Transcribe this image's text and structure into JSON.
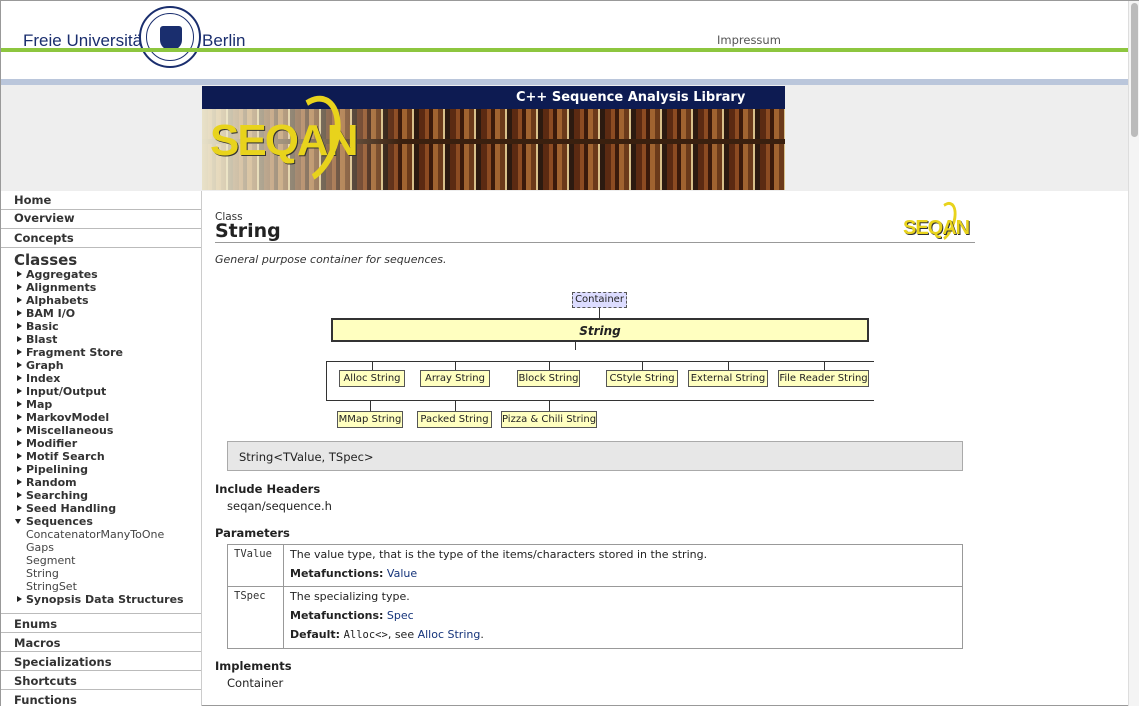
{
  "header": {
    "university_left": "Freie Universität",
    "university_right": "Berlin",
    "impressum": "Impressum"
  },
  "banner": {
    "title": "C++ Sequence Analysis Library",
    "logo_text": "SEQAN"
  },
  "sidebar": {
    "top_links": [
      "Home",
      "Overview",
      "Concepts"
    ],
    "classes_heading": "Classes",
    "class_groups": [
      "Aggregates",
      "Alignments",
      "Alphabets",
      "BAM I/O",
      "Basic",
      "Blast",
      "Fragment Store",
      "Graph",
      "Index",
      "Input/Output",
      "Map",
      "MarkovModel",
      "Miscellaneous",
      "Modifier",
      "Motif Search",
      "Pipelining",
      "Random",
      "Searching",
      "Seed Handling"
    ],
    "expanded_group": "Sequences",
    "sequences_items": [
      "ConcatenatorManyToOne",
      "Gaps",
      "Segment",
      "String",
      "StringSet"
    ],
    "after_group": "Synopsis Data Structures",
    "bottom_links": [
      "Enums",
      "Macros",
      "Specializations",
      "Shortcuts",
      "Functions"
    ]
  },
  "main": {
    "class_label": "Class",
    "title": "String",
    "logo_text": "SEQAN",
    "summary": "General purpose container for sequences.",
    "diagram": {
      "parent": "Container",
      "center": "String",
      "row1": [
        "Alloc String",
        "Array String",
        "Block String",
        "CStyle String",
        "External String",
        "File Reader String"
      ],
      "row2": [
        "MMap String",
        "Packed String",
        "Pizza & Chili String"
      ]
    },
    "signature": "String<TValue, TSpec>",
    "include_heading": "Include Headers",
    "include_file": "seqan/sequence.h",
    "parameters_heading": "Parameters",
    "parameters": [
      {
        "name": "TValue",
        "description": "The value type, that is the type of the items/characters stored in the string.",
        "metafunctions_label": "Metafunctions:",
        "metafunctions": "Value"
      },
      {
        "name": "TSpec",
        "description": "The specializing type.",
        "metafunctions_label": "Metafunctions:",
        "metafunctions": "Spec",
        "default_label": "Default:",
        "default_code": "Alloc<>",
        "default_see": ", see",
        "default_link": "Alloc String",
        "default_end": "."
      }
    ],
    "implements_heading": "Implements",
    "implements": "Container"
  },
  "colors": {
    "brand_blue": "#1a2e6e",
    "fu_green": "#8dc63f",
    "banner_navy": "#0d1b52",
    "seqan_yellow": "#e8d31c",
    "diagram_fill": "#ffffc0",
    "parent_fill": "#dcdcff",
    "link": "#14337a"
  }
}
